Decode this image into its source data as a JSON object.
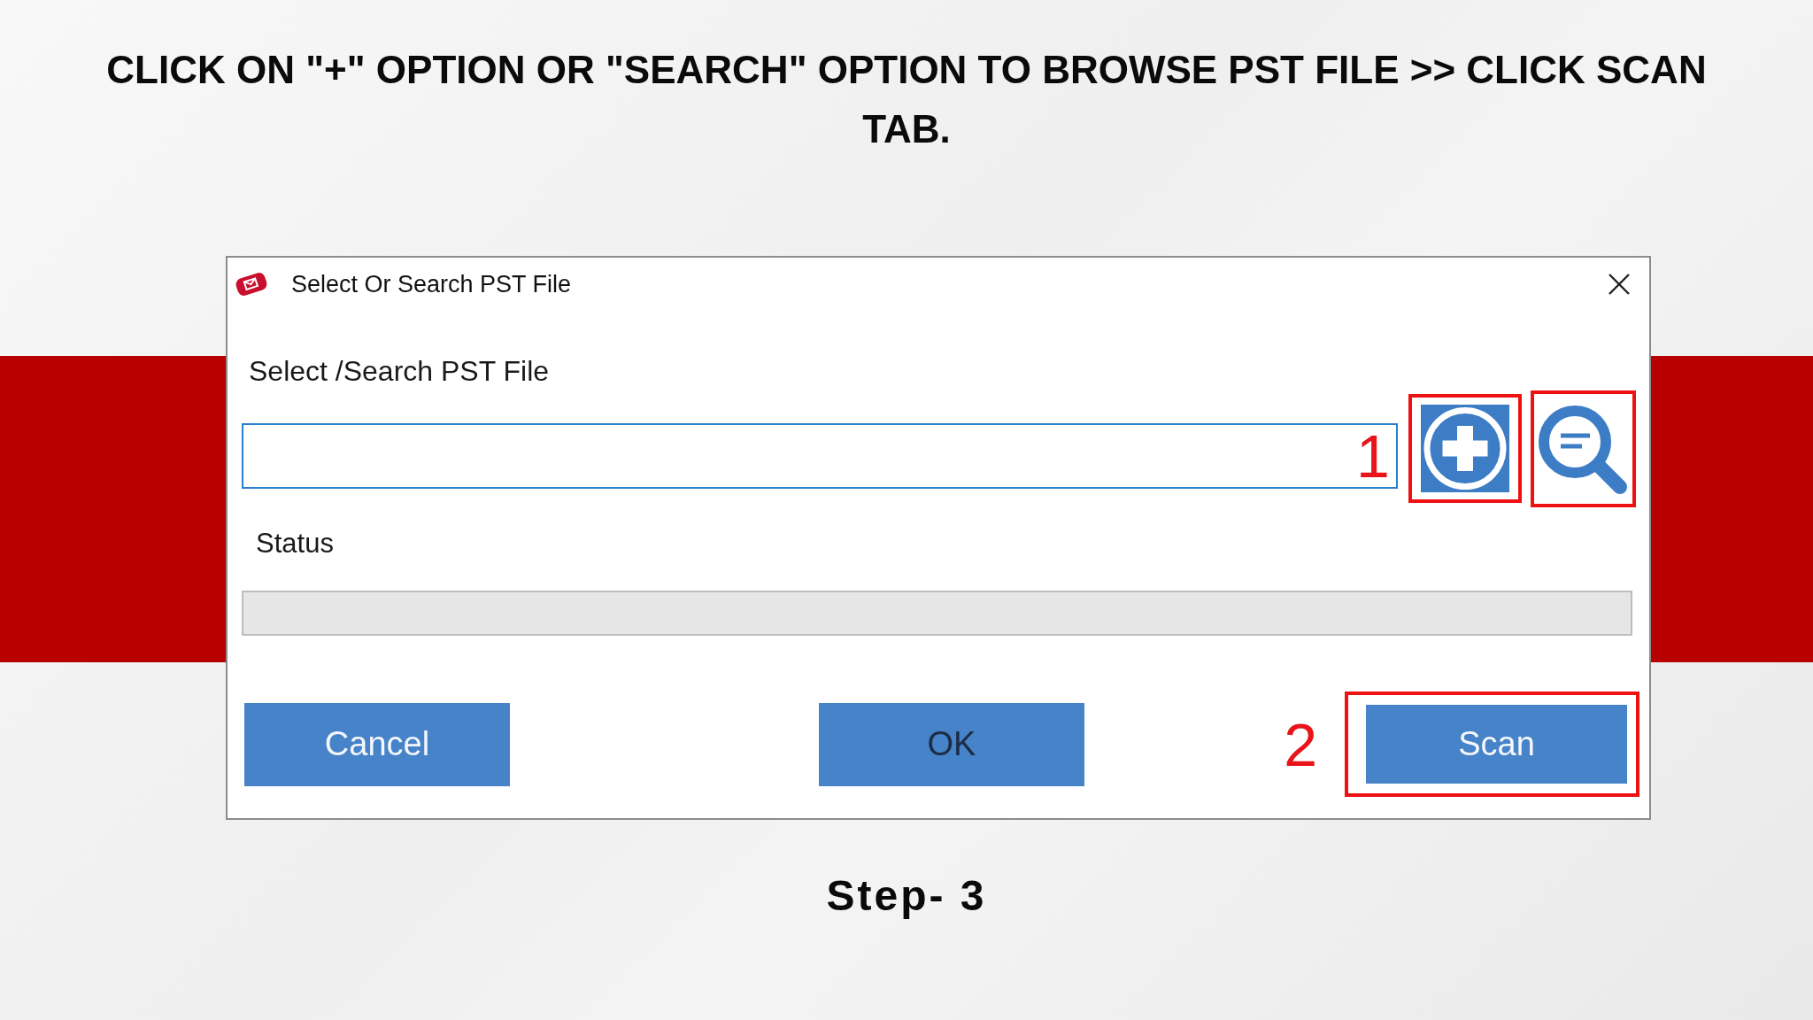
{
  "heading": "CLICK ON \"+\" OPTION OR \"SEARCH\" OPTION TO BROWSE PST FILE >> CLICK SCAN TAB.",
  "dialog": {
    "title": "Select Or Search PST File",
    "file_label": "Select /Search PST File",
    "file_field": {
      "marker": "1"
    },
    "file_actions": [
      {
        "kind": "add",
        "highlighted": true
      },
      {
        "kind": "search",
        "highlighted": true
      }
    ],
    "status_label": "Status",
    "status_bar": {
      "level": 0
    },
    "buttons": [
      {
        "label": "Cancel",
        "disabled": false,
        "highlighted": false
      },
      {
        "label": "OK",
        "disabled": true,
        "highlighted": false
      },
      {
        "label": "Scan",
        "disabled": false,
        "highlighted": true,
        "marker": "2"
      }
    ]
  },
  "caption": "Step- 3"
}
